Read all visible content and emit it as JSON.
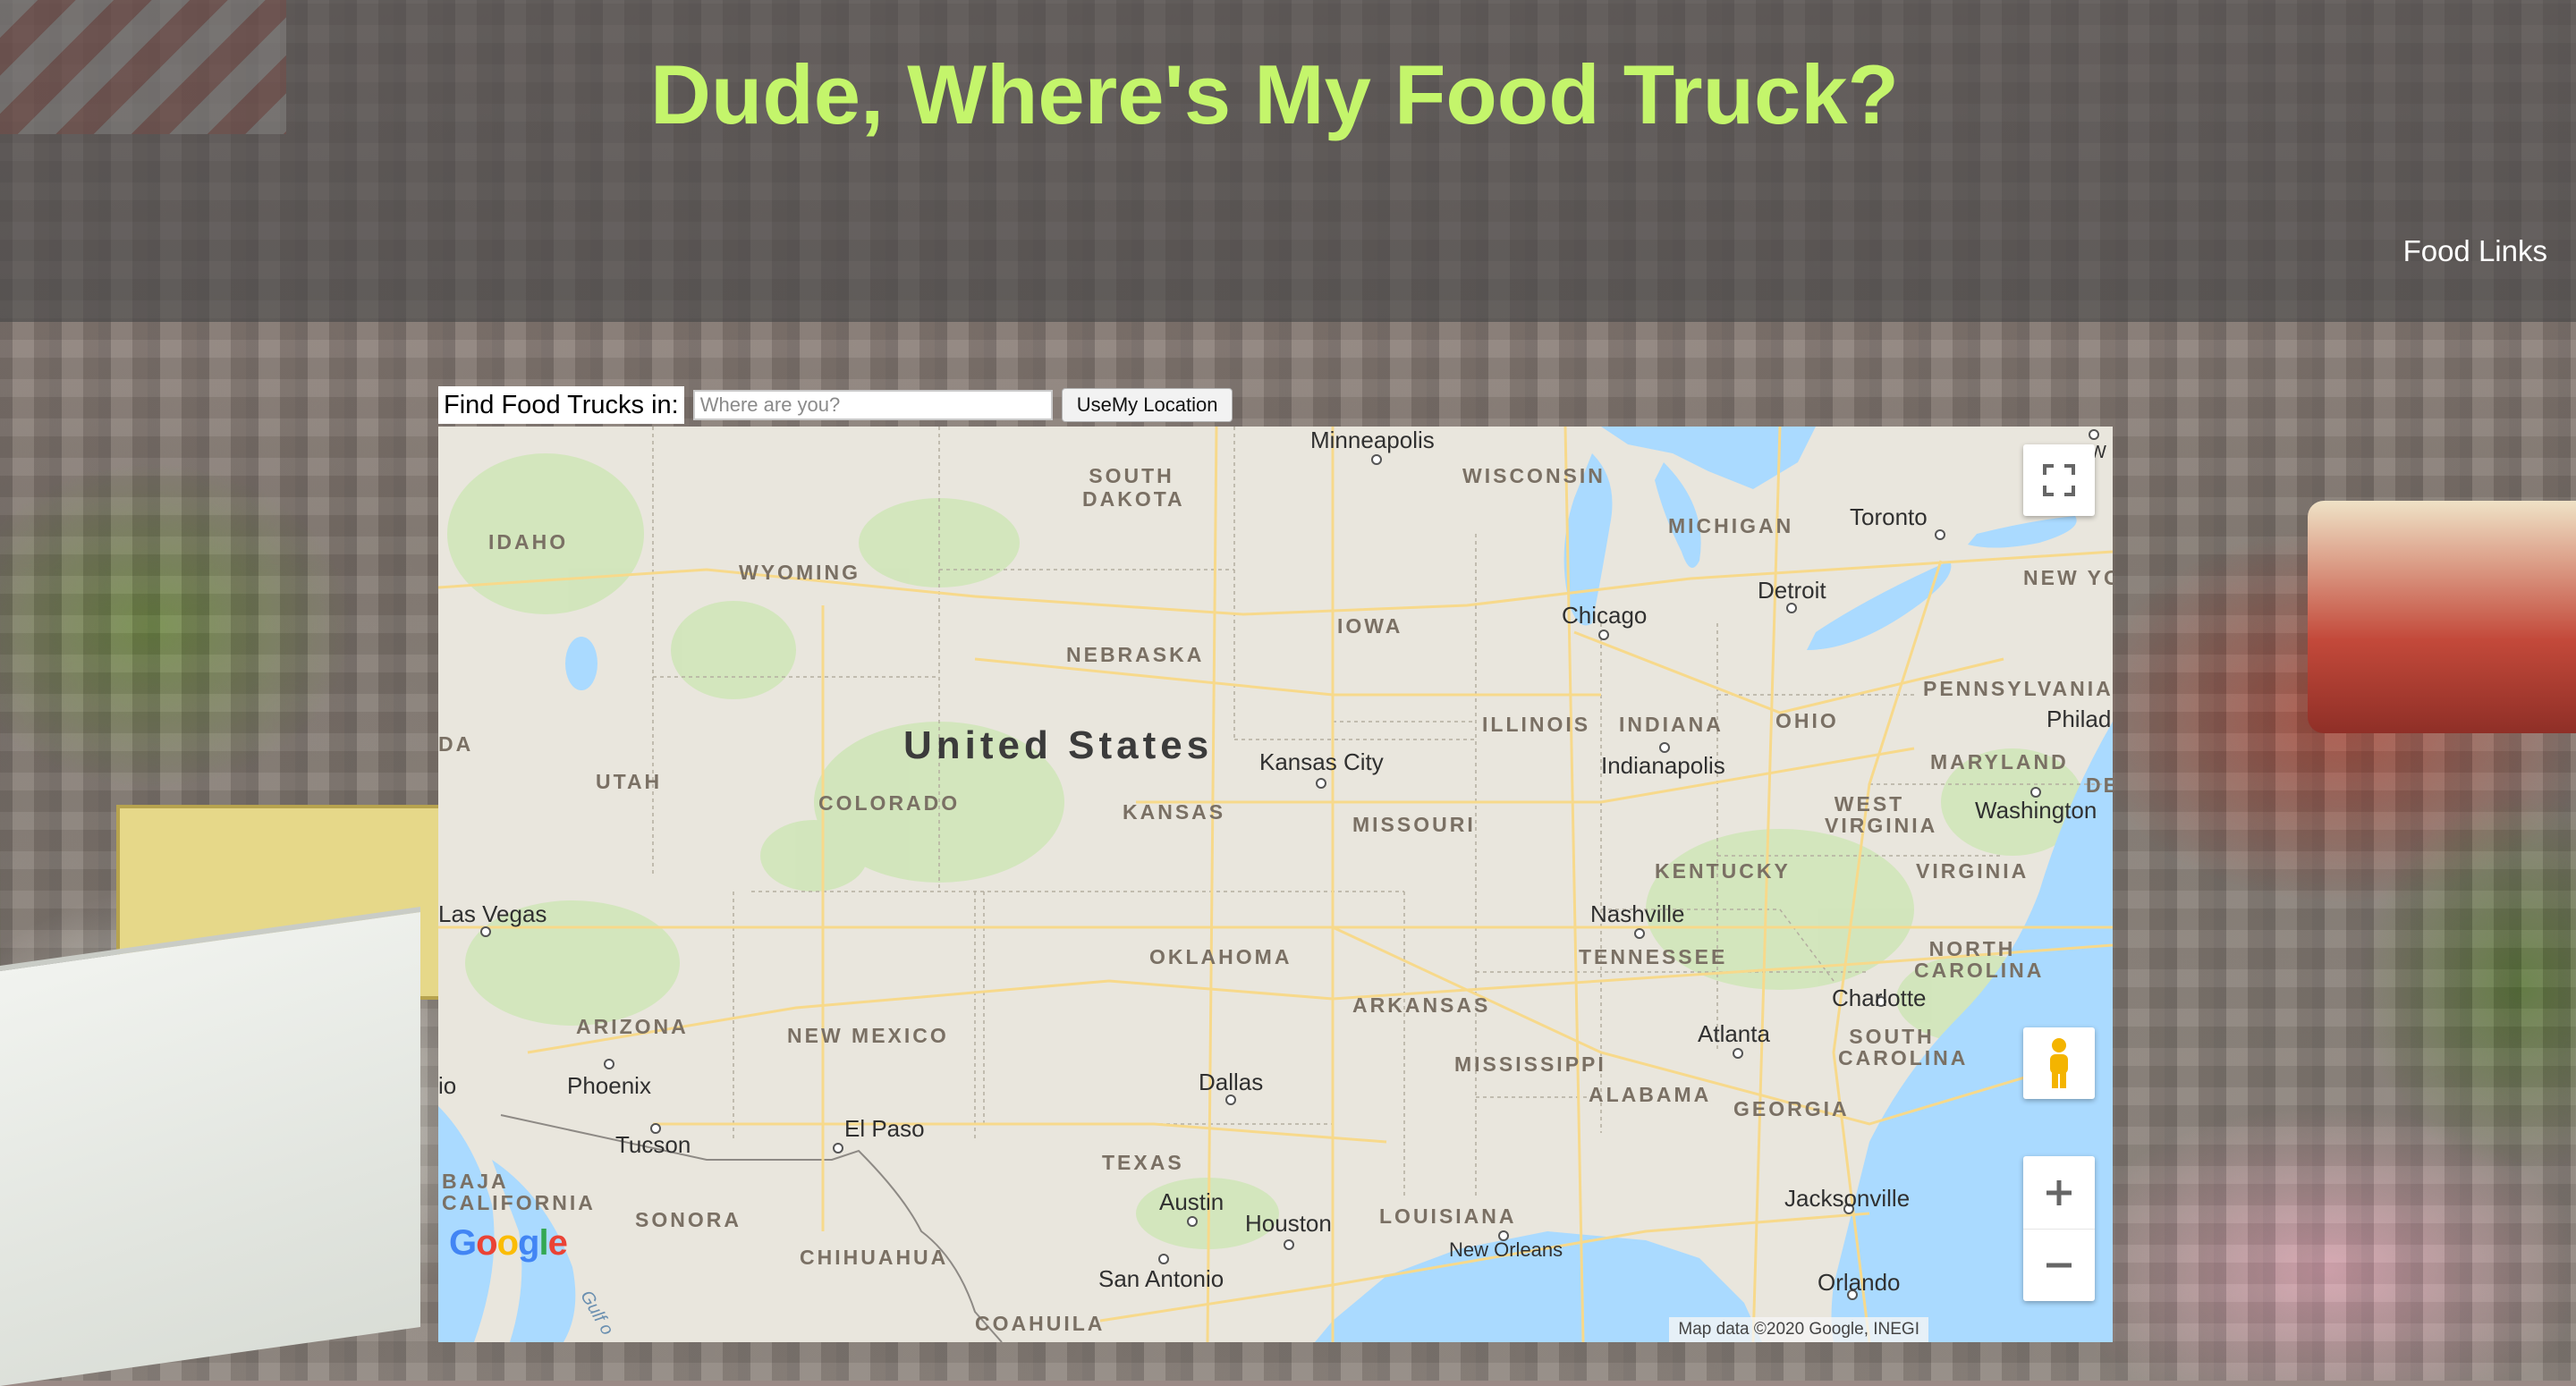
{
  "header": {
    "title": "Dude, Where's My Food Truck?",
    "nav_link": "Food Links"
  },
  "search": {
    "label": "Find Food Trucks in:",
    "placeholder": "Where are you?",
    "button": "UseMy Location"
  },
  "map": {
    "country_label": "United States",
    "attribution": "Map data ©2020 Google, INEGI",
    "logo": "Google",
    "states": [
      "SOUTH DAKOTA",
      "WISCONSIN",
      "MICHIGAN",
      "IDAHO",
      "WYOMING",
      "IOWA",
      "NEBRASKA",
      "PENNSYLVANIA",
      "ILLINOIS",
      "INDIANA",
      "OHIO",
      "UTAH",
      "COLORADO",
      "KANSAS",
      "MISSOURI",
      "MARYLAND",
      "WEST VIRGINIA",
      "KENTUCKY",
      "VIRGINIA",
      "TENNESSEE",
      "NORTH CAROLINA",
      "OKLAHOMA",
      "ARKANSAS",
      "ARIZONA",
      "NEW MEXICO",
      "MISSISSIPPI",
      "SOUTH CAROLINA",
      "ALABAMA",
      "GEORGIA",
      "TEXAS",
      "LOUISIANA",
      "BAJA CALIFORNIA",
      "SONORA",
      "CHIHUAHUA",
      "COAHUILA",
      "NEW YOR",
      "DE",
      "DA"
    ],
    "cities": [
      "Minneapolis",
      "Toronto",
      "Detroit",
      "Chicago",
      "Philad",
      "Kansas City",
      "Indianapolis",
      "Washington",
      "Nashville",
      "Las Vegas",
      "Charlotte",
      "Atlanta",
      "Phoenix",
      "Dallas",
      "El Paso",
      "Tucson",
      "Austin",
      "Houston",
      "New Orleans",
      "Jacksonville",
      "San Antonio",
      "Orlando",
      "Gulf o",
      "W",
      "io"
    ],
    "controls": {
      "fullscreen": "fullscreen-icon",
      "pegman": "pegman-icon",
      "zoom_in": "plus-icon",
      "zoom_out": "minus-icon"
    },
    "colors": {
      "land": "#e9e6dd",
      "water": "#aadaff",
      "roads": "#f7d98b",
      "green": "#cde5b5"
    }
  }
}
